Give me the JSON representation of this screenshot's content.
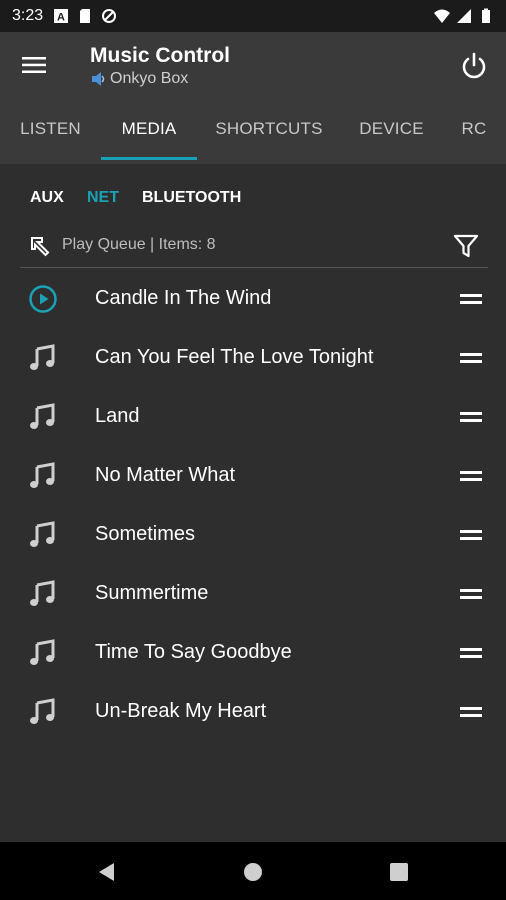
{
  "status_bar": {
    "time": "3:23",
    "left_icons": [
      "a-icon",
      "sd-card-icon",
      "sync-blocked-icon"
    ],
    "right_icons": [
      "wifi-icon",
      "signal-icon",
      "battery-icon"
    ]
  },
  "app_bar": {
    "title": "Music Control",
    "subtitle": "Onkyo Box",
    "subtitle_icon": "speaker-icon",
    "menu_icon": "hamburger-icon",
    "power_icon": "power-icon"
  },
  "tabs": [
    {
      "label": "LISTEN",
      "active": false
    },
    {
      "label": "MEDIA",
      "active": true
    },
    {
      "label": "SHORTCUTS",
      "active": false
    },
    {
      "label": "DEVICE",
      "active": false
    },
    {
      "label": "RC",
      "active": false
    }
  ],
  "inputs": [
    {
      "label": "AUX",
      "active": false
    },
    {
      "label": "NET",
      "active": true
    },
    {
      "label": "BLUETOOTH",
      "active": false
    }
  ],
  "queue": {
    "label": "Play Queue | Items: 8",
    "back_icon": "arrow-up-left-icon",
    "filter_icon": "filter-icon"
  },
  "tracks": [
    {
      "title": "Candle In The Wind",
      "icon": "play-circle-icon",
      "playing": true
    },
    {
      "title": "Can You Feel The Love Tonight",
      "icon": "music-note-icon",
      "playing": false
    },
    {
      "title": "Land",
      "icon": "music-note-icon",
      "playing": false
    },
    {
      "title": "No Matter What",
      "icon": "music-note-icon",
      "playing": false
    },
    {
      "title": "Sometimes",
      "icon": "music-note-icon",
      "playing": false
    },
    {
      "title": "Summertime",
      "icon": "music-note-icon",
      "playing": false
    },
    {
      "title": "Time To Say Goodbye",
      "icon": "music-note-icon",
      "playing": false
    },
    {
      "title": "Un-Break My Heart",
      "icon": "music-note-icon",
      "playing": false
    }
  ],
  "colors": {
    "accent": "#1ba1b5",
    "background": "#2e2e2e",
    "app_bar": "#3a3a3a"
  },
  "nav_bar": {
    "icons": [
      "back-icon",
      "home-icon",
      "recents-icon"
    ]
  }
}
